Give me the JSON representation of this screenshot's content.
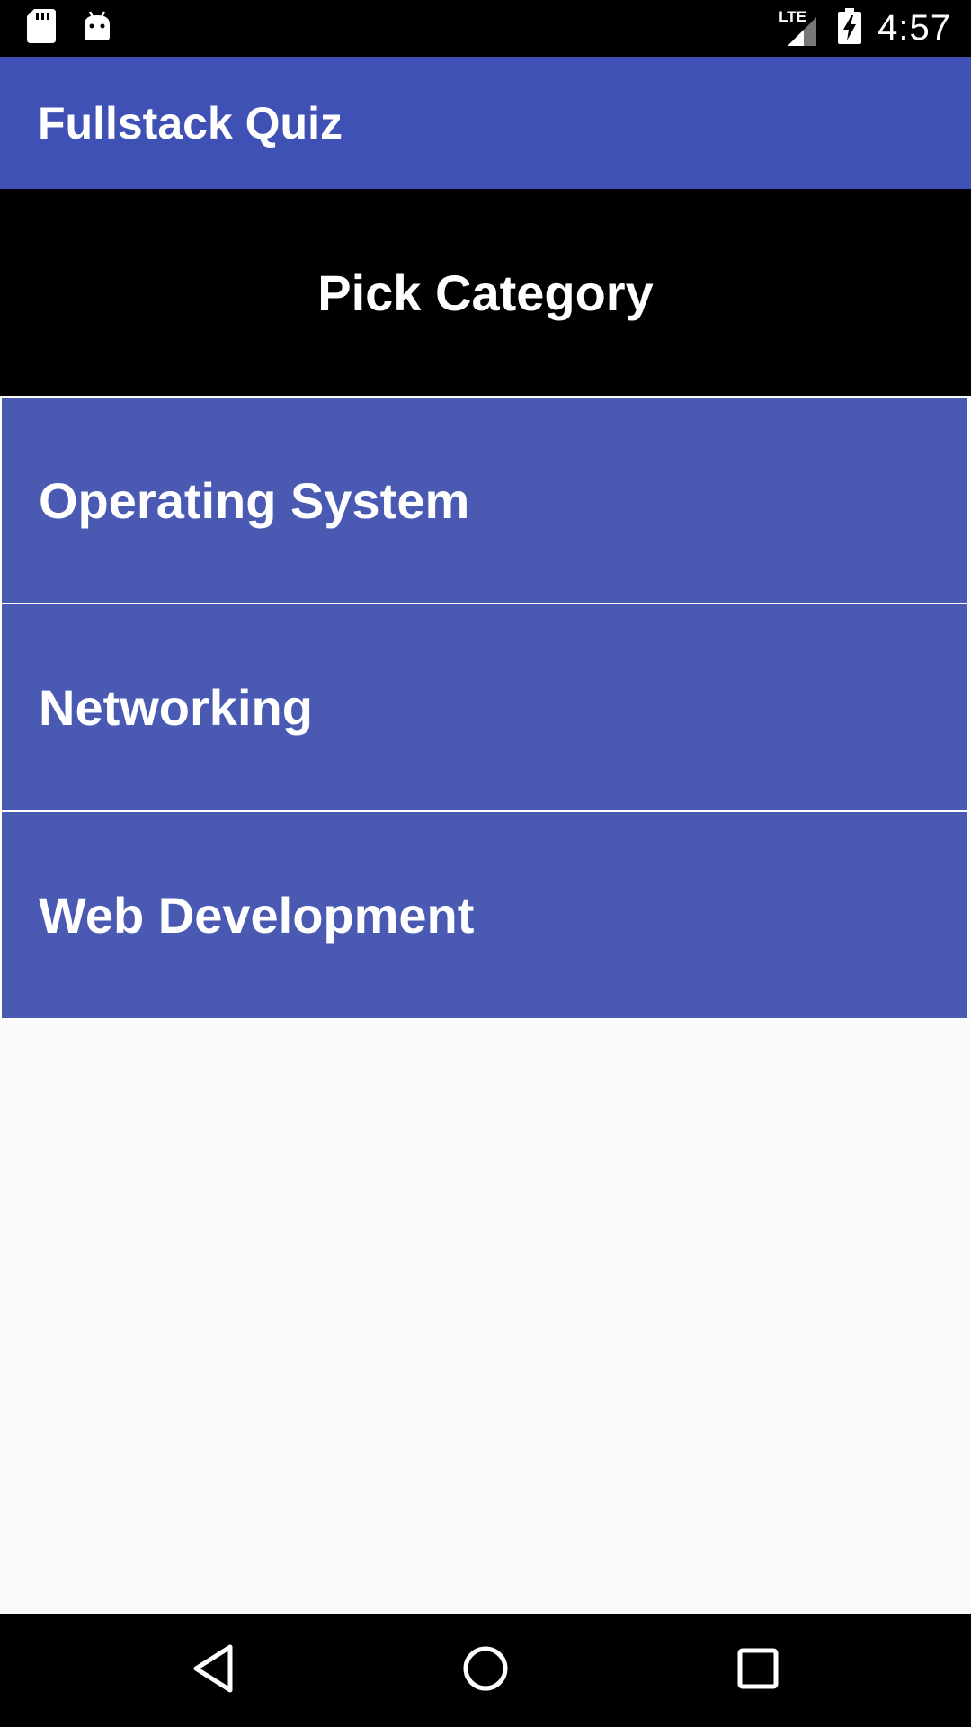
{
  "status_bar": {
    "time": "4:57",
    "network_label": "LTE",
    "left_icons": [
      "sd-card-icon",
      "android-debug-icon"
    ],
    "right_icons": [
      "lte-signal-icon",
      "battery-charging-icon"
    ]
  },
  "app_bar": {
    "title": "Fullstack Quiz",
    "color": "#3f51b5"
  },
  "header": {
    "title": "Pick Category"
  },
  "categories": [
    {
      "label": "Operating System"
    },
    {
      "label": "Networking"
    },
    {
      "label": "Web Development"
    }
  ],
  "nav_bar": {
    "buttons": [
      "back-icon",
      "home-icon",
      "recents-icon"
    ]
  },
  "colors": {
    "status_bar": "#000000",
    "header_bg": "#000000",
    "category_bg": "#4a5ab2",
    "page_bg": "#fafafa"
  }
}
